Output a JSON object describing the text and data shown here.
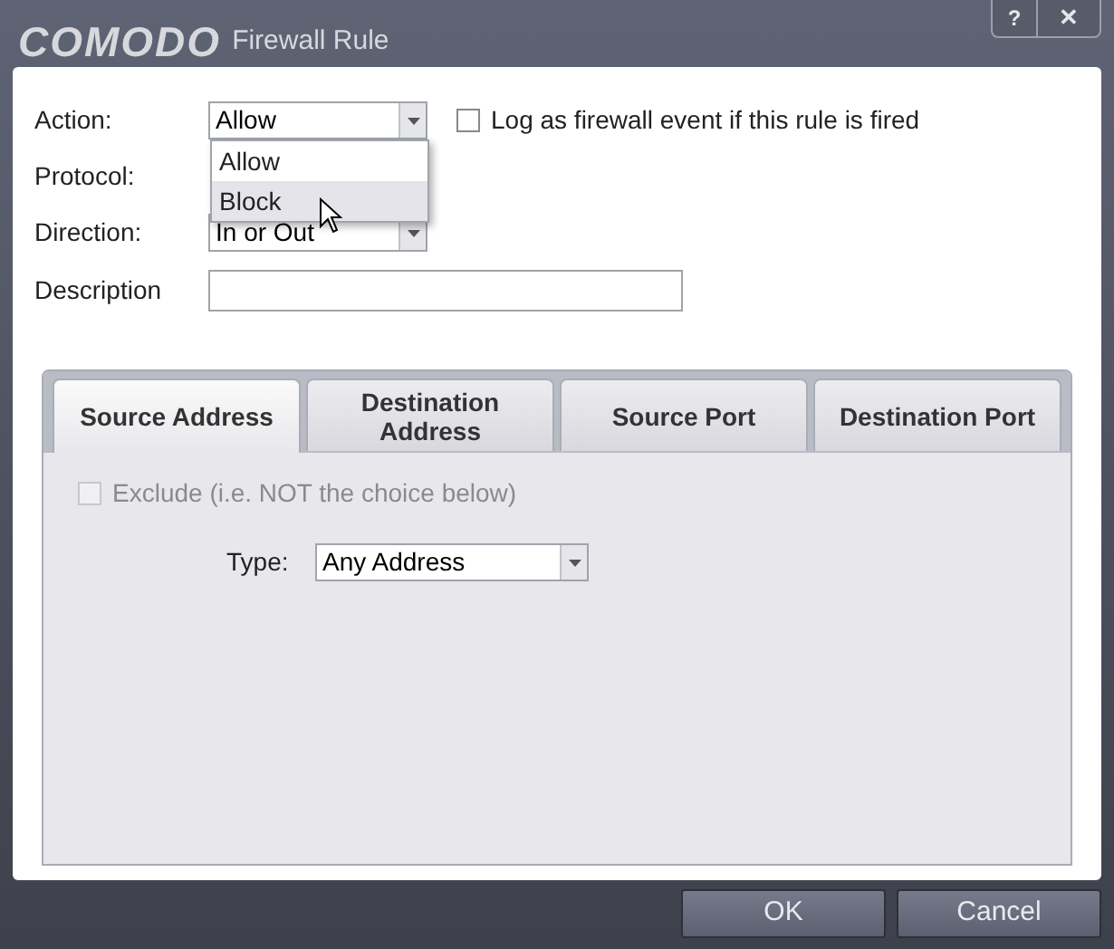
{
  "window": {
    "logo": "COMODO",
    "title": "Firewall Rule",
    "help": "?",
    "close": "✕"
  },
  "form": {
    "action": {
      "label": "Action:",
      "value": "Allow"
    },
    "log_checkbox": {
      "label": "Log as firewall event if this rule is fired",
      "checked": false
    },
    "protocol": {
      "label": "Protocol:"
    },
    "direction": {
      "label": "Direction:",
      "value": "In or Out"
    },
    "description": {
      "label": "Description"
    }
  },
  "action_dropdown": {
    "options": [
      {
        "label": "Allow",
        "selected": false
      },
      {
        "label": "Block",
        "selected": true
      }
    ]
  },
  "tabs": [
    {
      "label": "Source Address",
      "selected": true
    },
    {
      "label": "Destination Address",
      "selected": false
    },
    {
      "label": "Source Port",
      "selected": false
    },
    {
      "label": "Destination Port",
      "selected": false
    }
  ],
  "tab_content": {
    "exclude": {
      "label": "Exclude (i.e. NOT the choice below)",
      "checked": false,
      "disabled": true
    },
    "type": {
      "label": "Type:",
      "value": "Any Address"
    }
  },
  "buttons": [
    "OK",
    "Cancel"
  ]
}
